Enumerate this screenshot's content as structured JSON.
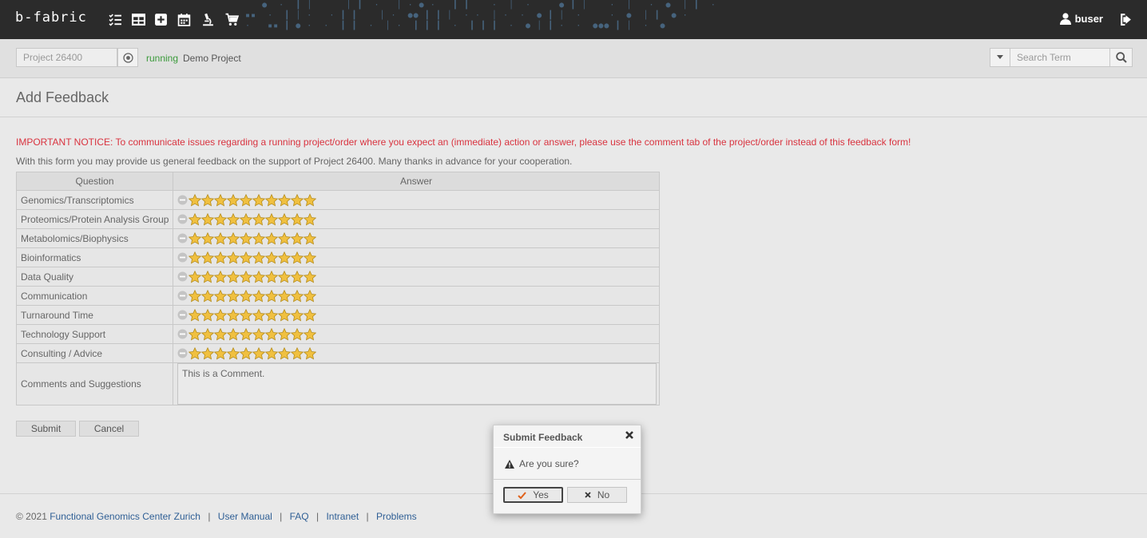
{
  "app": {
    "logo": "b-fabric",
    "user": "buser"
  },
  "header_icons": [
    "checklist-icon",
    "table-icon",
    "plus-square-icon",
    "calendar-icon",
    "microscope-icon",
    "cart-icon"
  ],
  "project": {
    "id_value": "Project 26400",
    "status": "running",
    "name": "Demo Project"
  },
  "search": {
    "placeholder": "Search Term"
  },
  "page": {
    "title": "Add Feedback",
    "notice": "IMPORTANT NOTICE: To communicate issues regarding a running project/order where you expect an (immediate) action or answer, please use the comment tab of the project/order instead of this feedback form!",
    "intro": "With this form you may provide us general feedback on the support of Project 26400. Many thanks in advance for your cooperation."
  },
  "table": {
    "headers": [
      "Question",
      "Answer"
    ],
    "questions": [
      "Genomics/Transcriptomics",
      "Proteomics/Protein Analysis Group",
      "Metabolomics/Biophysics",
      "Bioinformatics",
      "Data Quality",
      "Communication",
      "Turnaround Time",
      "Technology Support",
      "Consulting / Advice"
    ],
    "star_count": 10,
    "comment_label": "Comments and Suggestions",
    "comment_value": "This is a Comment."
  },
  "buttons": {
    "submit": "Submit",
    "cancel": "Cancel"
  },
  "footer": {
    "copyright": "© 2021",
    "org": "Functional Genomics Center Zurich",
    "links": [
      "User Manual",
      "FAQ",
      "Intranet",
      "Problems"
    ]
  },
  "dialog": {
    "title": "Submit Feedback",
    "message": "Are you sure?",
    "yes": "Yes",
    "no": "No"
  },
  "colors": {
    "topbar": "#2b2b2b",
    "notice": "#d9333f",
    "status": "#3a9a3a",
    "link": "#2f5f95",
    "star": "#f0c040"
  }
}
